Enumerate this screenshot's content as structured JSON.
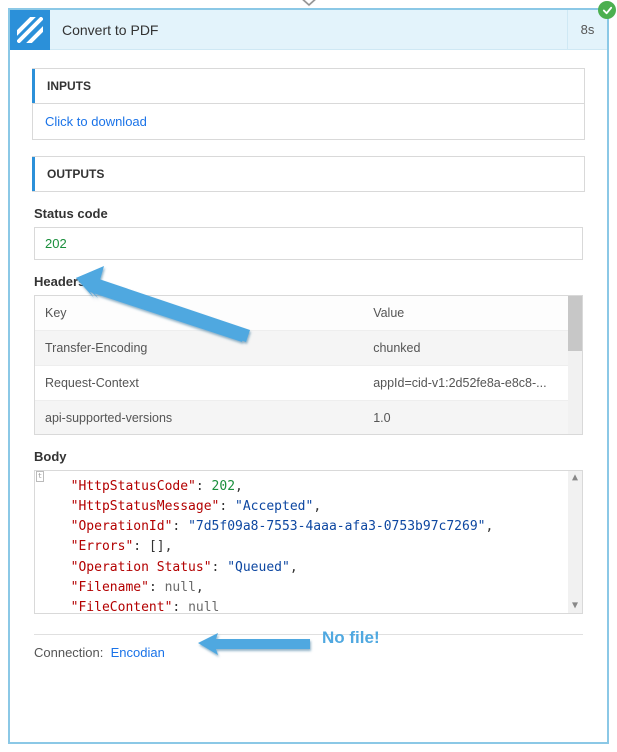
{
  "header": {
    "title": "Convert to PDF",
    "duration": "8s"
  },
  "inputs": {
    "heading": "INPUTS",
    "download_link": "Click to download"
  },
  "outputs": {
    "heading": "OUTPUTS",
    "status_code_label": "Status code",
    "status_code_value": "202",
    "headers_label": "Headers",
    "headers_table": {
      "col_key": "Key",
      "col_value": "Value",
      "rows": [
        {
          "key": "Transfer-Encoding",
          "value": "chunked"
        },
        {
          "key": "Request-Context",
          "value": "appId=cid-v1:2d52fe8a-e8c8-..."
        },
        {
          "key": "api-supported-versions",
          "value": "1.0"
        }
      ]
    },
    "body_label": "Body",
    "body_json": {
      "HttpStatusCode": 202,
      "HttpStatusMessage": "Accepted",
      "OperationId": "7d5f09a8-7553-4aaa-afa3-0753b97c7269",
      "Errors": [],
      "Operation Status": "Queued",
      "Filename": null,
      "FileContent": null
    }
  },
  "connection": {
    "label": "Connection:",
    "name": "Encodian"
  },
  "annotations": {
    "no_file": "No file!"
  },
  "colors": {
    "accent": "#2b90d9",
    "link": "#1a73e8",
    "arrow": "#4fa8e0",
    "success": "#4caf50"
  }
}
